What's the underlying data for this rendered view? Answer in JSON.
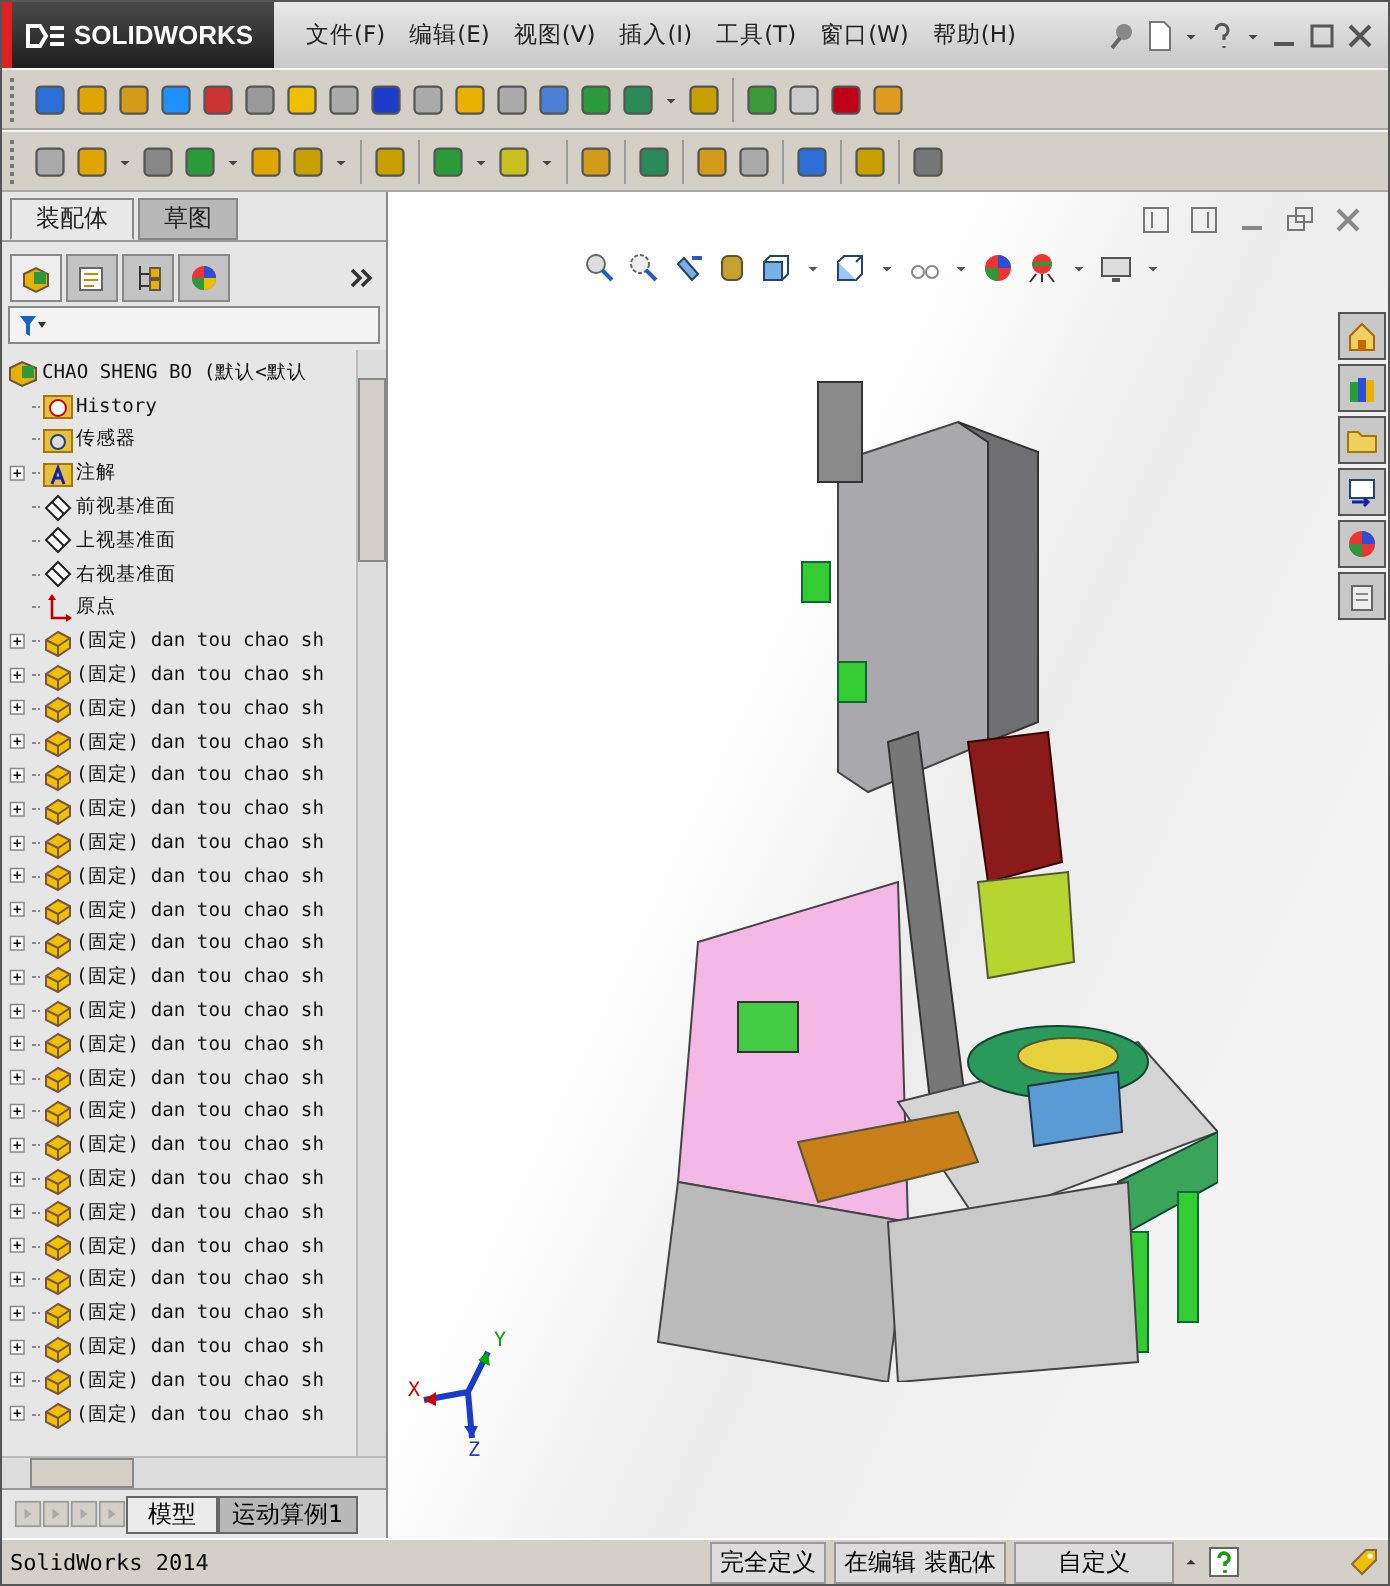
{
  "menubar": {
    "brand": "SOLIDWORKS",
    "menus": [
      "文件(F)",
      "编辑(E)",
      "视图(V)",
      "插入(I)",
      "工具(T)",
      "窗口(W)",
      "帮助(H)"
    ]
  },
  "panel_tabs": [
    {
      "label": "装配体",
      "selected": true
    },
    {
      "label": "草图",
      "selected": false
    }
  ],
  "manager_tabs": [
    {
      "kind": "feature",
      "selected": true
    },
    {
      "kind": "property",
      "selected": false
    },
    {
      "kind": "config",
      "selected": false
    },
    {
      "kind": "display",
      "selected": false
    }
  ],
  "tree": {
    "label": "CHAO SHENG BO  (默认<默认",
    "kind": "assembly",
    "children": [
      {
        "label": "History",
        "kind": "history",
        "expander": false
      },
      {
        "label": "传感器",
        "kind": "sensor",
        "expander": false
      },
      {
        "label": "注解",
        "kind": "annotation",
        "expander": true
      },
      {
        "label": "前视基准面",
        "kind": "plane",
        "expander": false
      },
      {
        "label": "上视基准面",
        "kind": "plane",
        "expander": false
      },
      {
        "label": "右视基准面",
        "kind": "plane",
        "expander": false
      },
      {
        "label": "原点",
        "kind": "origin",
        "expander": false
      },
      {
        "label": "(固定) dan tou chao sh",
        "kind": "part",
        "expander": true
      },
      {
        "label": "(固定) dan tou chao sh",
        "kind": "part",
        "expander": true
      },
      {
        "label": "(固定) dan tou chao sh",
        "kind": "part",
        "expander": true
      },
      {
        "label": "(固定) dan tou chao sh",
        "kind": "part",
        "expander": true
      },
      {
        "label": "(固定) dan tou chao sh",
        "kind": "part",
        "expander": true
      },
      {
        "label": "(固定) dan tou chao sh",
        "kind": "part",
        "expander": true
      },
      {
        "label": "(固定) dan tou chao sh",
        "kind": "part",
        "expander": true
      },
      {
        "label": "(固定) dan tou chao sh",
        "kind": "part",
        "expander": true
      },
      {
        "label": "(固定) dan tou chao sh",
        "kind": "part",
        "expander": true
      },
      {
        "label": "(固定) dan tou chao sh",
        "kind": "part",
        "expander": true
      },
      {
        "label": "(固定) dan tou chao sh",
        "kind": "part",
        "expander": true
      },
      {
        "label": "(固定) dan tou chao sh",
        "kind": "part",
        "expander": true
      },
      {
        "label": "(固定) dan tou chao sh",
        "kind": "part",
        "expander": true
      },
      {
        "label": "(固定) dan tou chao sh",
        "kind": "part",
        "expander": true
      },
      {
        "label": "(固定) dan tou chao sh",
        "kind": "part",
        "expander": true
      },
      {
        "label": "(固定) dan tou chao sh",
        "kind": "part",
        "expander": true
      },
      {
        "label": "(固定) dan tou chao sh",
        "kind": "part",
        "expander": true
      },
      {
        "label": "(固定) dan tou chao sh",
        "kind": "part",
        "expander": true
      },
      {
        "label": "(固定) dan tou chao sh",
        "kind": "part",
        "expander": true
      },
      {
        "label": "(固定) dan tou chao sh",
        "kind": "part",
        "expander": true
      },
      {
        "label": "(固定) dan tou chao sh",
        "kind": "part",
        "expander": true
      },
      {
        "label": "(固定) dan tou chao sh",
        "kind": "part",
        "expander": true
      },
      {
        "label": "(固定) dan tou chao sh",
        "kind": "part",
        "expander": true
      },
      {
        "label": "(固定) dan tou chao sh",
        "kind": "part",
        "expander": true
      }
    ]
  },
  "bottom_tabs": [
    {
      "label": "模型",
      "selected": true
    },
    {
      "label": "运动算例1",
      "selected": false
    }
  ],
  "triad": {
    "x_label": "X",
    "y_label": "Y",
    "z_label": "Z"
  },
  "status_bar": {
    "app": "SolidWorks 2014",
    "definition": "完全定义",
    "mode": "在编辑 装配体",
    "units": "自定义"
  }
}
